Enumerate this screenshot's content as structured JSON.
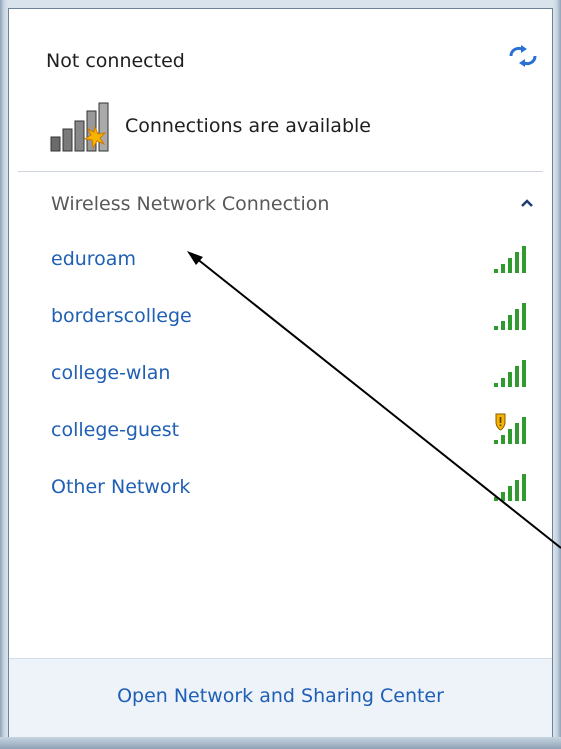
{
  "header": {
    "status": "Not connected",
    "connections_text": "Connections are available"
  },
  "section": {
    "title": "Wireless Network Connection"
  },
  "networks": [
    {
      "name": "eduroam",
      "secured": true
    },
    {
      "name": "borderscollege",
      "secured": true
    },
    {
      "name": "college-wlan",
      "secured": true
    },
    {
      "name": "college-guest",
      "secured": false,
      "warning_icon": "shield-warning-icon"
    },
    {
      "name": "Other Network",
      "secured": true
    }
  ],
  "footer": {
    "link": "Open Network and Sharing Center"
  },
  "colors": {
    "link": "#1f5fb4",
    "signal": "#2f9b2f",
    "panel_border": "#6f8196",
    "footer_bg": "#eef3fa"
  },
  "icons": {
    "refresh": "refresh-arrows-icon",
    "connections": "network-bars-star-icon",
    "collapse": "chevron-up-icon",
    "signal": "signal-bars-icon"
  }
}
